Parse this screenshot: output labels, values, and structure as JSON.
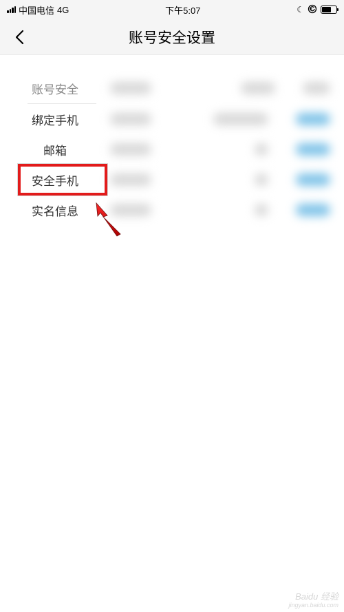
{
  "statusBar": {
    "carrier": "中国电信",
    "network": "4G",
    "time": "下午5:07"
  },
  "nav": {
    "title": "账号安全设置"
  },
  "rows": [
    {
      "label": "账号安全"
    },
    {
      "label": "绑定手机"
    },
    {
      "label": "邮箱"
    },
    {
      "label": "安全手机"
    },
    {
      "label": "实名信息"
    }
  ],
  "annotation": {
    "highlightedRowIndex": 3
  },
  "watermark": {
    "main": "Baidu 经验",
    "sub": "jingyan.baidu.com"
  }
}
